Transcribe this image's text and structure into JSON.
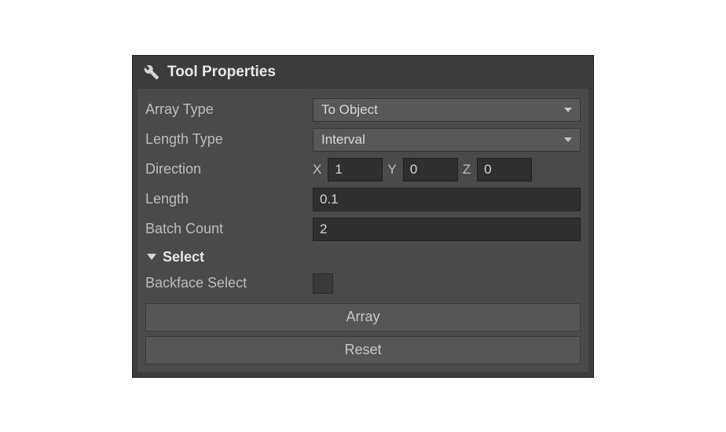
{
  "panelTitle": "Tool Properties",
  "labels": {
    "arrayType": "Array Type",
    "lengthType": "Length Type",
    "direction": "Direction",
    "length": "Length",
    "batchCount": "Batch Count",
    "backfaceSelect": "Backface Select"
  },
  "values": {
    "arrayType": "To Object",
    "lengthType": "Interval",
    "directionX": "1",
    "directionY": "0",
    "directionZ": "0",
    "length": "0.1",
    "batchCount": "2",
    "backfaceSelect": false
  },
  "axis": {
    "x": "X",
    "y": "Y",
    "z": "Z"
  },
  "section": {
    "select": "Select"
  },
  "buttons": {
    "array": "Array",
    "reset": "Reset"
  }
}
